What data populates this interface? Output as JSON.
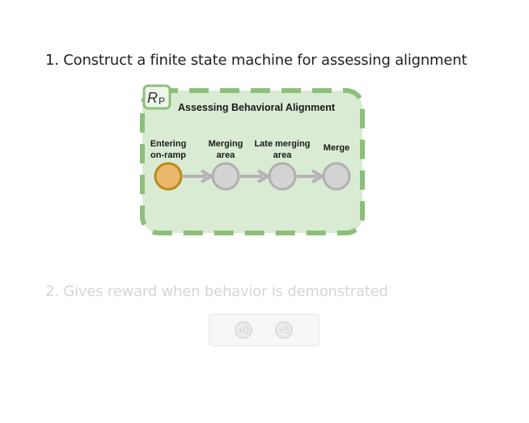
{
  "steps": [
    {
      "label": "1. Construct a finite state machine for assessing alignment"
    },
    {
      "label": "2. Gives reward when behavior is demonstrated"
    }
  ],
  "fsm": {
    "badge": "R",
    "badge_subscript": "P",
    "title": "Assessing Behavioral Alignment",
    "states": [
      {
        "label_lines": [
          "Entering",
          "on-ramp"
        ],
        "active": true
      },
      {
        "label_lines": [
          "Merging",
          "area"
        ],
        "active": false
      },
      {
        "label_lines": [
          "Late merging",
          "area"
        ],
        "active": false
      },
      {
        "label_lines": [
          "Merge"
        ],
        "active": false
      }
    ],
    "colors": {
      "panel_fill": "#d9ebd3",
      "panel_border": "#8cc07a",
      "active_fill": "#eab86a",
      "active_stroke": "#b88a1c",
      "inactive_fill": "#d3d3d3",
      "inactive_stroke": "#b0b0b0",
      "arrow": "#b4b4b4"
    }
  },
  "rewards": [
    {
      "label": "+0"
    },
    {
      "label": "+5"
    }
  ]
}
